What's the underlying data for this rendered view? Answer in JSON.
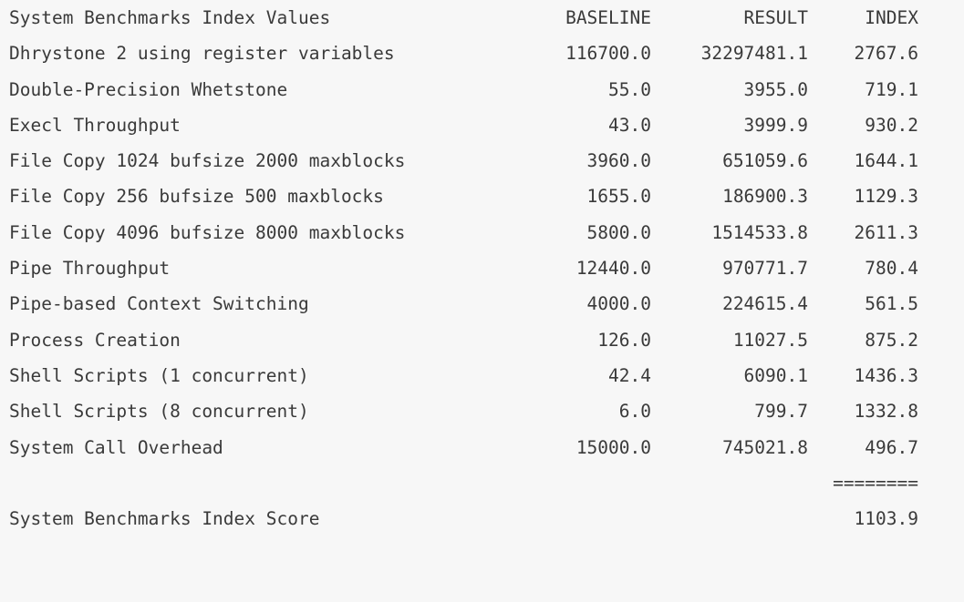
{
  "report": {
    "header": {
      "title": "System Benchmarks Index Values",
      "baseline": "BASELINE",
      "result": "RESULT",
      "index": "INDEX"
    },
    "rows": [
      {
        "name": "Dhrystone 2 using register variables",
        "baseline": "116700.0",
        "result": "32297481.1",
        "index": "2767.6"
      },
      {
        "name": "Double-Precision Whetstone",
        "baseline": "55.0",
        "result": "3955.0",
        "index": "719.1"
      },
      {
        "name": "Execl Throughput",
        "baseline": "43.0",
        "result": "3999.9",
        "index": "930.2"
      },
      {
        "name": "File Copy 1024 bufsize 2000 maxblocks",
        "baseline": "3960.0",
        "result": "651059.6",
        "index": "1644.1"
      },
      {
        "name": "File Copy 256 bufsize 500 maxblocks",
        "baseline": "1655.0",
        "result": "186900.3",
        "index": "1129.3"
      },
      {
        "name": "File Copy 4096 bufsize 8000 maxblocks",
        "baseline": "5800.0",
        "result": "1514533.8",
        "index": "2611.3"
      },
      {
        "name": "Pipe Throughput",
        "baseline": "12440.0",
        "result": "970771.7",
        "index": "780.4"
      },
      {
        "name": "Pipe-based Context Switching",
        "baseline": "4000.0",
        "result": "224615.4",
        "index": "561.5"
      },
      {
        "name": "Process Creation",
        "baseline": "126.0",
        "result": "11027.5",
        "index": "875.2"
      },
      {
        "name": "Shell Scripts (1 concurrent)",
        "baseline": "42.4",
        "result": "6090.1",
        "index": "1436.3"
      },
      {
        "name": "Shell Scripts (8 concurrent)",
        "baseline": "6.0",
        "result": "799.7",
        "index": "1332.8"
      },
      {
        "name": "System Call Overhead",
        "baseline": "15000.0",
        "result": "745021.8",
        "index": "496.7"
      }
    ],
    "separator": "========",
    "score": {
      "label": "System Benchmarks Index Score",
      "value": "1103.9"
    }
  }
}
